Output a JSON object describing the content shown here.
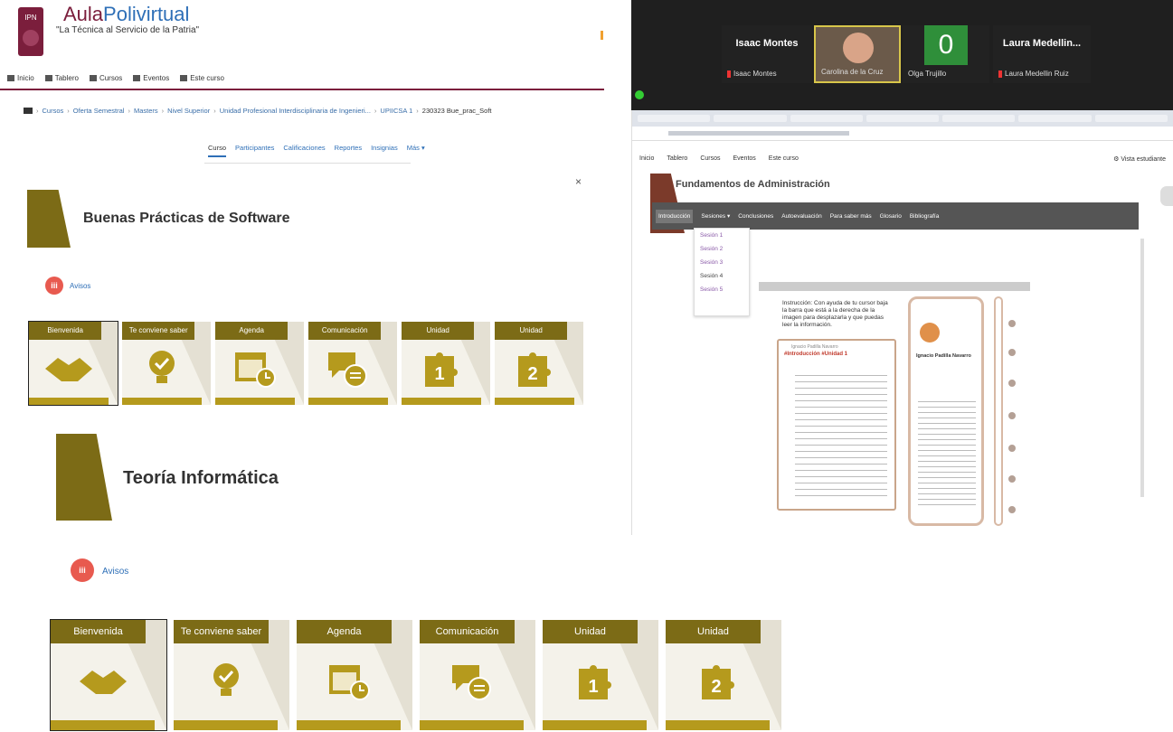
{
  "left": {
    "brand_part1": "Aula",
    "brand_part2": "Polivirtual",
    "tagline": "\"La Técnica al Servicio de la Patria\"",
    "nav": [
      "Inicio",
      "Tablero",
      "Cursos",
      "Eventos",
      "Este curso"
    ],
    "breadcrumbs": [
      "Cursos",
      "Oferta Semestral",
      "Masters",
      "Nivel Superior",
      "Unidad Profesional Interdisciplinaria de Ingenieri...",
      "UPIICSA 1",
      "230323 Bue_prac_Soft"
    ],
    "tabs": [
      "Curso",
      "Participantes",
      "Calificaciones",
      "Reportes",
      "Insignias",
      "Más ▾"
    ],
    "close": "×",
    "section1_title": "Buenas Prácticas de Software",
    "section2_title": "Teoría Informática",
    "avisos_icon": "iii",
    "avisos": "Avisos",
    "tiles": [
      {
        "label": "Bienvenida",
        "icon": "handshake-icon"
      },
      {
        "label": "Te conviene saber",
        "icon": "lightbulb-icon"
      },
      {
        "label": "Agenda",
        "icon": "calendar-icon"
      },
      {
        "label": "Comunicación",
        "icon": "chat-icon"
      },
      {
        "label": "Unidad",
        "icon": "puzzle-icon",
        "digit": "1"
      },
      {
        "label": "Unidad",
        "icon": "puzzle-icon",
        "digit": "2"
      }
    ]
  },
  "zoom": {
    "participants": [
      {
        "big": "Isaac Montes",
        "small": "Isaac Montes"
      },
      {
        "big": "",
        "small": "Carolina de la Cruz"
      },
      {
        "big": "0",
        "small": "Olga Trujillo"
      },
      {
        "big": "Laura Medellin...",
        "small": "Laura Medellin Ruiz"
      }
    ]
  },
  "browser": {
    "nav": [
      "Inicio",
      "Tablero",
      "Cursos",
      "Eventos",
      "Este curso"
    ],
    "edit_mode": "Vista estudiante",
    "course_title": "Fundamentos de Administración",
    "menu": [
      "Introducción",
      "Sesiones ▾",
      "Conclusiones",
      "Autoevaluación",
      "Para saber más",
      "Glosario",
      "Bibliografía"
    ],
    "sessions": [
      "Sesión 1",
      "Sesión 2",
      "Sesión 3",
      "Sesión 4",
      "Sesión 5"
    ],
    "instruction": "Instrucción: Con ayuda de tu cursor baja la barra que está a la derecha de la imagen para desplazarla y que puedas leer la información.",
    "card_author": "Ignacio Padilla Navarro",
    "card_title": "#Introducción #Unidad 1",
    "phone_name": "Ignacio Padilla Navarro"
  }
}
